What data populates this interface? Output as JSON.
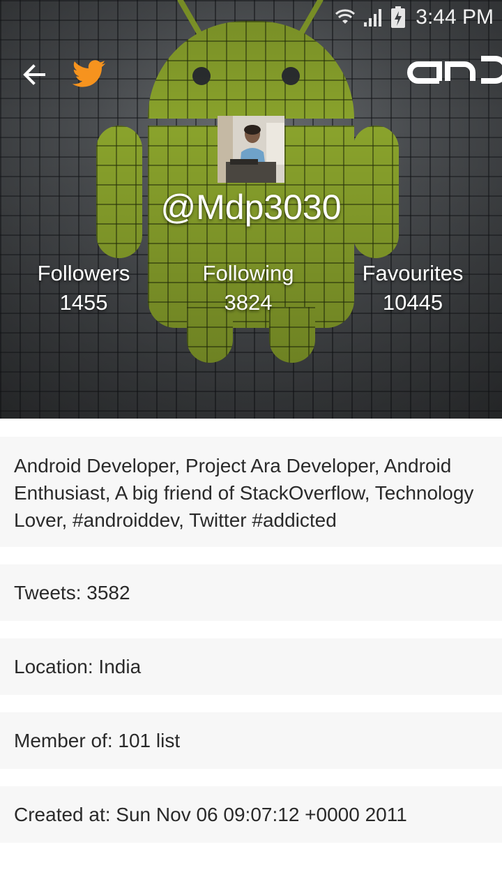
{
  "status_bar": {
    "time": "3:44 PM",
    "icons": [
      "wifi-icon",
      "signal-icon",
      "battery-charging-icon"
    ]
  },
  "toolbar": {
    "back_icon": "arrow-left-icon",
    "app_icon": "twitter-bird-icon",
    "brand_logo_text": "and"
  },
  "profile": {
    "handle": "@Mdp3030",
    "avatar_icon": "profile-photo",
    "stats": {
      "followers_label": "Followers",
      "followers_value": "1455",
      "following_label": "Following",
      "following_value": "3824",
      "favourites_label": "Favourites",
      "favourites_value": "10445"
    }
  },
  "details": {
    "bio": "Android Developer, Project Ara Developer, Android Enthusiast, A big friend of StackOverflow, Technology Lover, #androiddev, Twitter #addicted",
    "tweets": "Tweets: 3582",
    "location": "Location: India",
    "member_of": "Member of: 101 list",
    "created_at": "Created at: Sun Nov 06 09:07:12 +0000 2011"
  },
  "colors": {
    "twitter_accent": "#f6931e",
    "android_green": "#8aa32c",
    "card_background": "#f7f7f7",
    "text": "#2a2a2a"
  }
}
